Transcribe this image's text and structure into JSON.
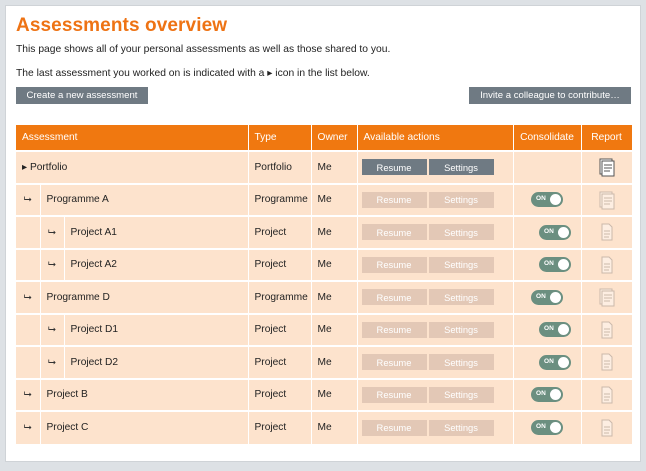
{
  "header": {
    "title": "Assessments overview",
    "intro": "This page shows all of your personal assessments as well as those shared to you.",
    "hint": "The last assessment you worked on is indicated with a ▸ icon in the list below."
  },
  "toolbar": {
    "create_label": "Create a new assessment",
    "invite_label": "Invite a colleague to contribute…"
  },
  "table": {
    "columns": {
      "assessment": "Assessment",
      "type": "Type",
      "owner": "Owner",
      "actions": "Available actions",
      "consolidate": "Consolidate",
      "report": "Report"
    },
    "resume_label": "Resume",
    "settings_label": "Settings",
    "toggle_label": "ON",
    "child_arrow": "⮡",
    "rows": [
      {
        "name": "▸ Portfolio",
        "type": "Portfolio",
        "owner": "Me",
        "actions_enabled": true,
        "consolidate": null,
        "report_icon": "report-active-icon"
      },
      {
        "name": "Programme A",
        "type": "Programme",
        "owner": "Me",
        "actions_enabled": false,
        "consolidate": true,
        "report_icon": "report-multi-icon"
      },
      {
        "name": "Project A1",
        "type": "Project",
        "owner": "Me",
        "actions_enabled": false,
        "consolidate": true,
        "report_icon": "report-icon"
      },
      {
        "name": "Project A2",
        "type": "Project",
        "owner": "Me",
        "actions_enabled": false,
        "consolidate": true,
        "report_icon": "report-icon"
      },
      {
        "name": "Programme D",
        "type": "Programme",
        "owner": "Me",
        "actions_enabled": false,
        "consolidate": true,
        "report_icon": "report-multi-icon"
      },
      {
        "name": "Project D1",
        "type": "Project",
        "owner": "Me",
        "actions_enabled": false,
        "consolidate": true,
        "report_icon": "report-icon"
      },
      {
        "name": "Project D2",
        "type": "Project",
        "owner": "Me",
        "actions_enabled": false,
        "consolidate": true,
        "report_icon": "report-icon"
      },
      {
        "name": "Project B",
        "type": "Project",
        "owner": "Me",
        "actions_enabled": false,
        "consolidate": true,
        "report_icon": "report-icon"
      },
      {
        "name": "Project C",
        "type": "Project",
        "owner": "Me",
        "actions_enabled": false,
        "consolidate": true,
        "report_icon": "report-icon"
      }
    ]
  },
  "colors": {
    "accent": "#ee7314",
    "header_bg": "#f07810",
    "row_bg": "#fde3cd",
    "button_bg": "#6f7a83",
    "button_disabled": "#e3c8b6",
    "toggle_on": "#6b8f80"
  }
}
